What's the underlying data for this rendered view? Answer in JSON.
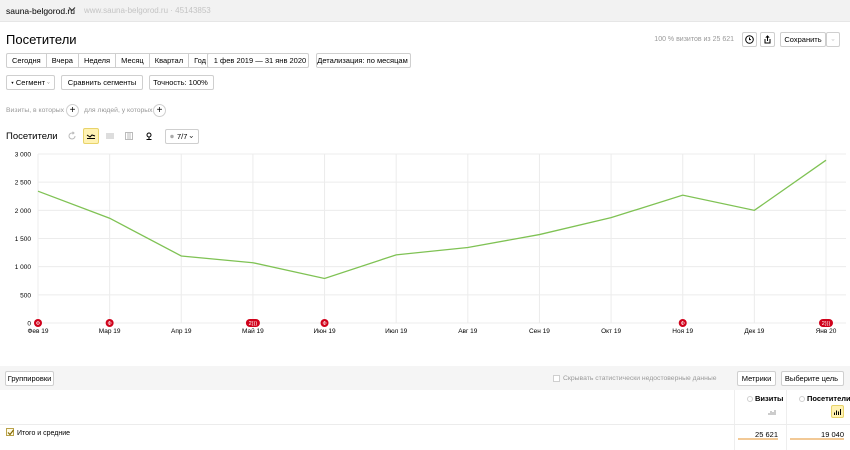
{
  "header": {
    "site_name": "sauna-belgorod.ru",
    "site_url": "www.sauna-belgorod.ru · 45143853"
  },
  "page": {
    "title": "Посетители",
    "visits_info": "100 % визитов из 25 621",
    "save_label": "Сохранить"
  },
  "period_tabs": [
    "Сегодня",
    "Вчера",
    "Неделя",
    "Месяц",
    "Квартал",
    "Год"
  ],
  "date_range": "1 фев 2019 — 31 янв 2020",
  "detail": "Детализация: по месяцам",
  "filters": {
    "segment": "Сегмент",
    "compare": "Сравнить сегменты",
    "accuracy": "Точность: 100%"
  },
  "add_filters": {
    "visits_label": "Визиты, в которых",
    "people_label": "для людей, у которых",
    "plus": "+"
  },
  "chart_toolbar": {
    "title": "Посетители",
    "series_count": "7/7"
  },
  "chart_data": {
    "type": "line",
    "title": "",
    "x": [
      "Фев 19",
      "Мар 19",
      "Апр 19",
      "Май 19",
      "Июн 19",
      "Июл 19",
      "Авг 19",
      "Сен 19",
      "Окт 19",
      "Ноя 19",
      "Дек 19",
      "Янв 20"
    ],
    "series": [
      {
        "values": [
          2340,
          1860,
          1190,
          1070,
          790,
          1210,
          1340,
          1570,
          1870,
          2270,
          2000,
          2890
        ]
      }
    ],
    "y_ticks": [
      "0",
      "500",
      "1 000",
      "1 500",
      "2 000",
      "2 500",
      "3 000"
    ],
    "ylim": [
      0,
      3000
    ],
    "grid": true,
    "line_color": "#7fc254",
    "annotation_color": "#d0021b",
    "annotations": [
      {
        "x": "Фев 19",
        "label": "Ф"
      },
      {
        "x": "Мар 19",
        "label": "Ф"
      },
      {
        "x": "Май 19",
        "label": "2)))"
      },
      {
        "x": "Июн 19",
        "label": "Ф"
      },
      {
        "x": "Ноя 19",
        "label": "Ф"
      },
      {
        "x": "Янв 20",
        "label": "2)))"
      }
    ]
  },
  "table": {
    "groupings_label": "Группировки",
    "hide_unreliable_label": "Скрывать статистически недостоверные данные",
    "metrics_label": "Метрики",
    "goal_label": "Выберите цель",
    "columns": [
      {
        "name": "Визиты",
        "total": "25 621"
      },
      {
        "name": "Посетители",
        "total": "19 040"
      }
    ],
    "totals_label": "Итого и средние"
  },
  "colors": {
    "accent_yellow": "#fff2b3",
    "total_bar": "#f2c996"
  }
}
